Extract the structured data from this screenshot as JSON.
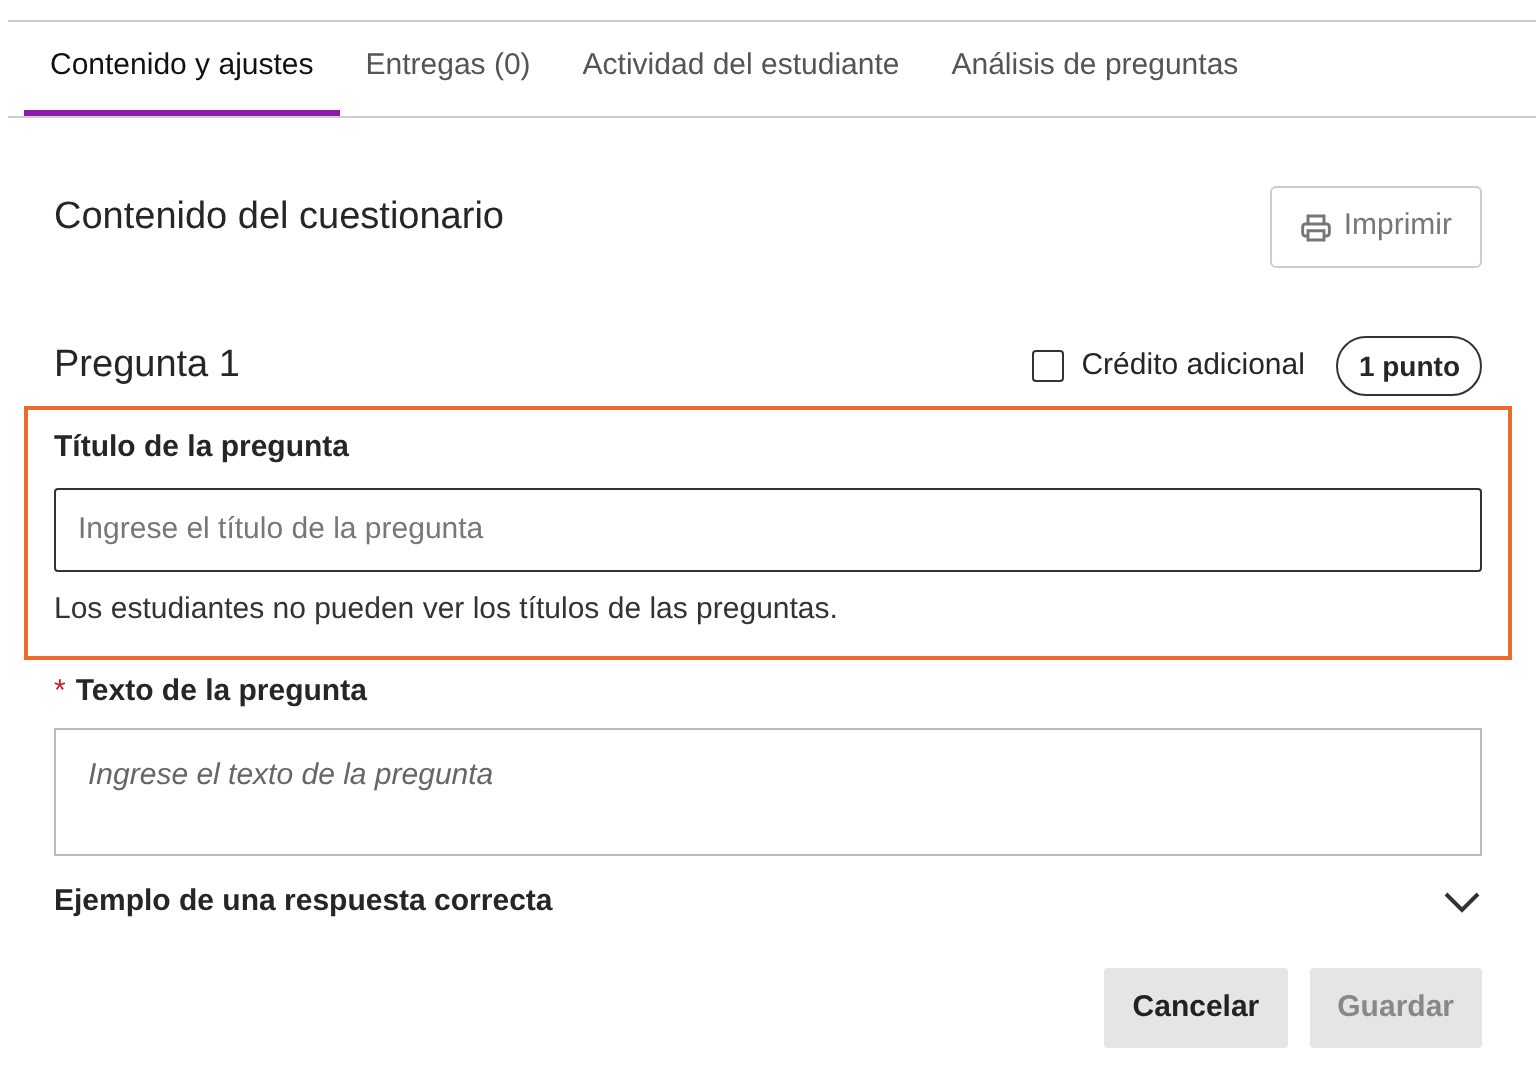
{
  "tabs": [
    {
      "label": "Contenido y ajustes",
      "selected": true
    },
    {
      "label": "Entregas (0)",
      "selected": false
    },
    {
      "label": "Actividad del estudiante",
      "selected": false
    },
    {
      "label": "Análisis de preguntas",
      "selected": false
    }
  ],
  "section_title": "Contenido del cuestionario",
  "print_button": "Imprimir",
  "question": {
    "title": "Pregunta 1",
    "extra_credit": {
      "label": "Crédito adicional",
      "checked": false
    },
    "points": "1 punto",
    "title_field": {
      "label": "Título de la pregunta",
      "placeholder": "Ingrese el título de la pregunta",
      "help": "Los estudiantes no pueden ver los títulos de las preguntas.",
      "highlighted": true
    },
    "text_field": {
      "required_mark": "*",
      "label": "Texto de la pregunta",
      "placeholder": "Ingrese el texto de la pregunta"
    },
    "sample_answer": {
      "label": "Ejemplo de una respuesta correcta",
      "expanded": false
    }
  },
  "buttons": [
    {
      "label": "Cancelar",
      "disabled": false
    },
    {
      "label": "Guardar",
      "disabled": true
    }
  ]
}
